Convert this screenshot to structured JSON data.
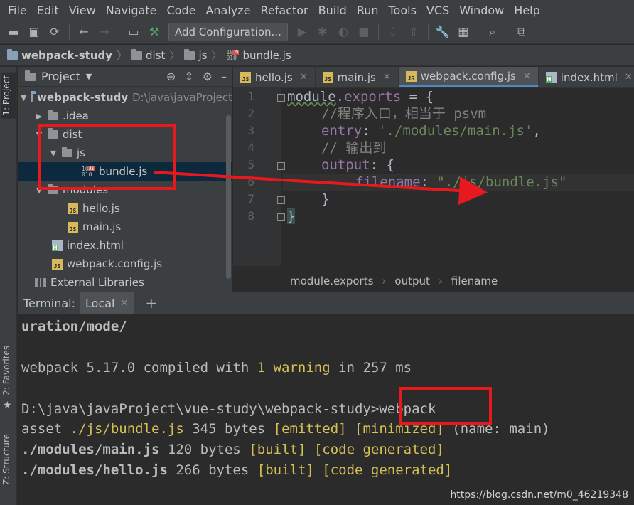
{
  "menu": [
    "File",
    "Edit",
    "View",
    "Navigate",
    "Code",
    "Analyze",
    "Refactor",
    "Build",
    "Run",
    "Tools",
    "VCS",
    "Window",
    "Help"
  ],
  "toolbar": {
    "add_configuration": "Add Configuration..."
  },
  "nav": {
    "project": "webpack-study",
    "dist": "dist",
    "js": "js",
    "file": "bundle.js"
  },
  "left_strip": {
    "project_tab": "1: Project",
    "favorites_tab": "2: Favorites",
    "structure_tab": "Z: Structure"
  },
  "project_panel": {
    "title": "Project",
    "tree": {
      "root": "webpack-study",
      "root_path": "D:\\java\\javaProject",
      "idea": ".idea",
      "dist": "dist",
      "js": "js",
      "bundle": "bundle.js",
      "modules": "modules",
      "hello": "hello.js",
      "main": "main.js",
      "index": "index.html",
      "config": "webpack.config.js",
      "libraries": "External Libraries"
    }
  },
  "editor": {
    "tabs": [
      "hello.js",
      "main.js",
      "webpack.config.js",
      "index.html"
    ],
    "line_numbers": [
      "1",
      "2",
      "3",
      "4",
      "5",
      "6",
      "7",
      "8"
    ],
    "code": {
      "l1a": "module",
      "l1b": ".",
      "l1c": "exports",
      "l1d": " = {",
      "l2": "//程序入口，相当于 psvm",
      "l3a": "entry",
      "l3b": ": ",
      "l3c": "'./modules/main.js'",
      "l3d": ",",
      "l4": "// 输出到",
      "l5a": "output",
      "l5b": ": {",
      "l6a": "filename",
      "l6b": ": ",
      "l6c": "\"./js/bundle.js\"",
      "l7": "}",
      "l8": "}"
    },
    "breadcrumb": [
      "module.exports",
      "output",
      "filename"
    ]
  },
  "terminal": {
    "tab_label": "Terminal:",
    "local_tab": "Local",
    "lines": {
      "l1": "uration/mode/",
      "l2a": "webpack 5.17.0 compiled with ",
      "l2b": "1 warning",
      "l2c": " in 257 ms",
      "l3a": "D:\\java\\javaProject\\vue-study\\webpack-study>",
      "l3b": "webpack",
      "l4a": "asset ",
      "l4b": "./js/bundle.js",
      "l4c": " 345 bytes ",
      "l4d": "[emitted] [minimized]",
      "l4e": " (name: main)",
      "l5a": "./modules/main.js",
      "l5b": " 120 bytes ",
      "l5c": "[built] [code generated]",
      "l6a": "./modules/hello.js",
      "l6b": " 266 bytes ",
      "l6c": "[built] [code generated]"
    }
  },
  "watermark": "https://blog.csdn.net/m0_46219348",
  "colors": {
    "annotation_red": "#e8191e",
    "selection": "#0d293e",
    "string_green": "#6a8759",
    "property_purple": "#9876aa"
  }
}
